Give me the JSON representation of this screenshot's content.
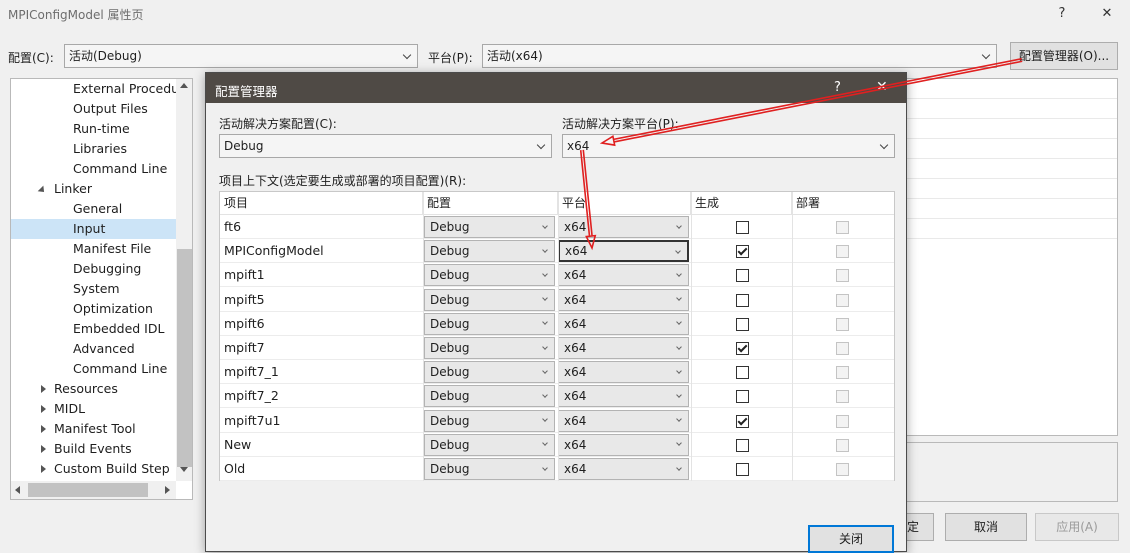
{
  "window": {
    "title": "MPIConfigModel 属性页",
    "help_label": "?",
    "close_label": "✕"
  },
  "toolbar": {
    "config_label": "配置(C):",
    "config_value": "活动(Debug)",
    "platform_label": "平台(P):",
    "platform_value": "活动(x64)",
    "config_manager_button": "配置管理器(O)..."
  },
  "tree": {
    "items": [
      {
        "label": "External Procedur",
        "indent": 2
      },
      {
        "label": "Output Files",
        "indent": 2
      },
      {
        "label": "Run-time",
        "indent": 2
      },
      {
        "label": "Libraries",
        "indent": 2
      },
      {
        "label": "Command Line",
        "indent": 2
      },
      {
        "label": "Linker",
        "indent": 1,
        "expanded": true
      },
      {
        "label": "General",
        "indent": 2
      },
      {
        "label": "Input",
        "indent": 2,
        "selected": true
      },
      {
        "label": "Manifest File",
        "indent": 2
      },
      {
        "label": "Debugging",
        "indent": 2
      },
      {
        "label": "System",
        "indent": 2
      },
      {
        "label": "Optimization",
        "indent": 2
      },
      {
        "label": "Embedded IDL",
        "indent": 2
      },
      {
        "label": "Advanced",
        "indent": 2
      },
      {
        "label": "Command Line",
        "indent": 2
      },
      {
        "label": "Resources",
        "indent": 1,
        "collapsed": true
      },
      {
        "label": "MIDL",
        "indent": 1,
        "collapsed": true
      },
      {
        "label": "Manifest Tool",
        "indent": 1,
        "collapsed": true
      },
      {
        "label": "Build Events",
        "indent": 1,
        "collapsed": true
      },
      {
        "label": "Custom Build Step",
        "indent": 1,
        "collapsed": true
      }
    ]
  },
  "footer": {
    "ok_label": "确定",
    "cancel_label": "取消",
    "apply_label": "应用(A)"
  },
  "modal": {
    "title": "配置管理器",
    "help_label": "?",
    "close_label": "✕",
    "solution_config_label": "活动解决方案配置(C):",
    "solution_config_value": "Debug",
    "solution_platform_label": "活动解决方案平台(P):",
    "solution_platform_value": "x64",
    "project_contexts_label": "项目上下文(选定要生成或部署的项目配置)(R):",
    "columns": [
      "项目",
      "配置",
      "平台",
      "生成",
      "部署"
    ],
    "rows": [
      {
        "project": "ft6",
        "config": "Debug",
        "platform": "x64",
        "build": false
      },
      {
        "project": "MPIConfigModel",
        "config": "Debug",
        "platform": "x64",
        "build": true
      },
      {
        "project": "mpift1",
        "config": "Debug",
        "platform": "x64",
        "build": false
      },
      {
        "project": "mpift5",
        "config": "Debug",
        "platform": "x64",
        "build": false
      },
      {
        "project": "mpift6",
        "config": "Debug",
        "platform": "x64",
        "build": false
      },
      {
        "project": "mpift7",
        "config": "Debug",
        "platform": "x64",
        "build": true
      },
      {
        "project": "mpift7_1",
        "config": "Debug",
        "platform": "x64",
        "build": false
      },
      {
        "project": "mpift7_2",
        "config": "Debug",
        "platform": "x64",
        "build": false
      },
      {
        "project": "mpift7u1",
        "config": "Debug",
        "platform": "x64",
        "build": true
      },
      {
        "project": "New",
        "config": "Debug",
        "platform": "x64",
        "build": false
      },
      {
        "project": "Old",
        "config": "Debug",
        "platform": "x64",
        "build": false
      }
    ],
    "close_button": "关闭"
  },
  "annotation": {
    "arrow_color": "#e02020"
  }
}
